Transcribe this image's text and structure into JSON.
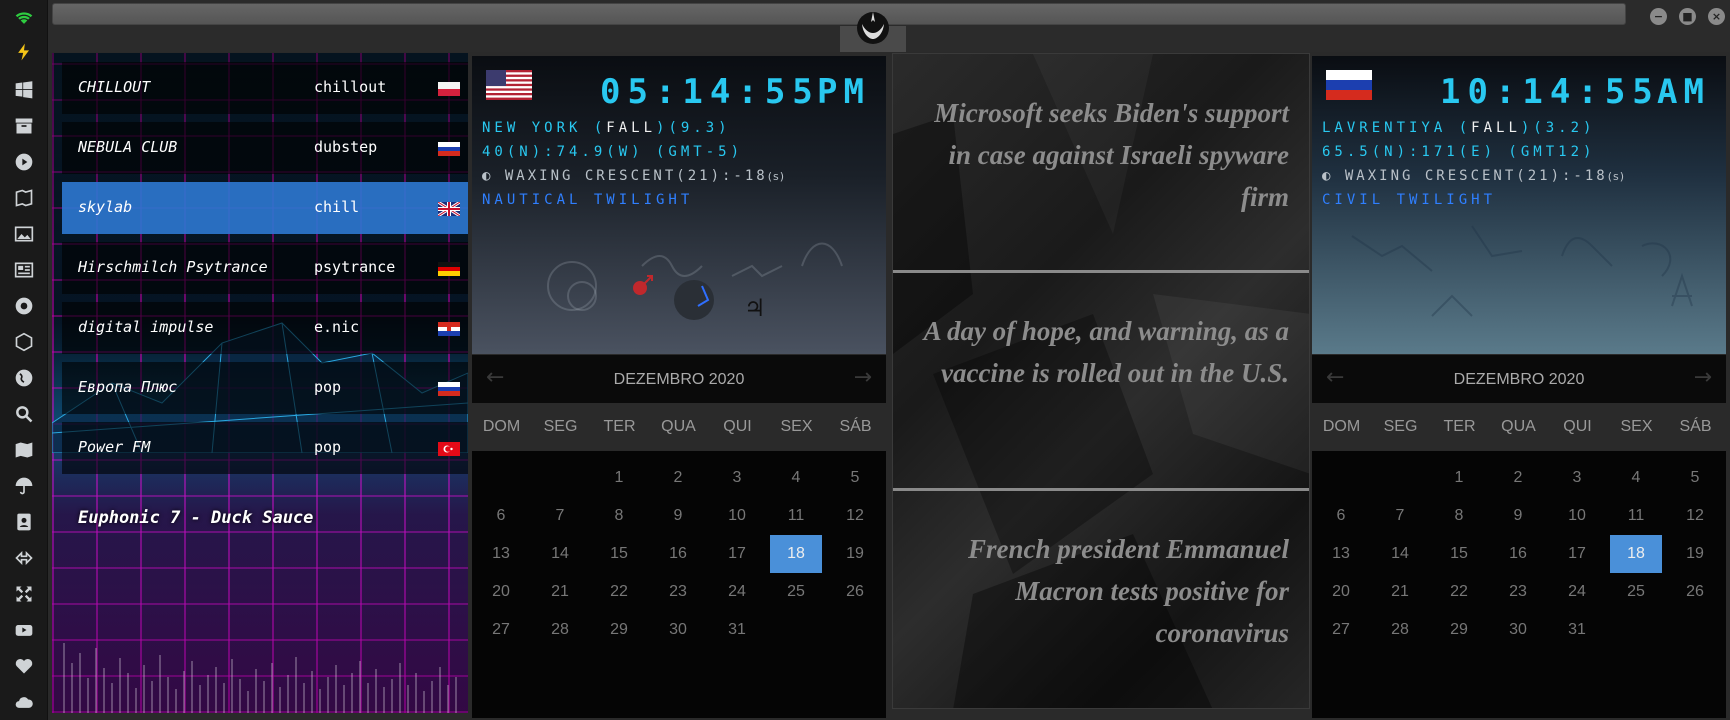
{
  "sidebar": {
    "icons": [
      "wifi-icon",
      "bolt-icon",
      "windows-icon",
      "archive-icon",
      "play-icon",
      "globe-book-icon",
      "image-icon",
      "newspaper-icon",
      "empire-icon",
      "hexagon-icon",
      "globe-icon",
      "search-icon",
      "map-icon",
      "umbrella-icon",
      "contact-icon",
      "exchange-icon",
      "expand-icon",
      "youtube-icon",
      "heart-icon",
      "cloud-icon"
    ],
    "accent": "#2ecc40"
  },
  "window": {
    "minimize": "−",
    "maximize": "■",
    "close": "×"
  },
  "radio": {
    "stations": [
      {
        "name": "CHILLOUT",
        "genre": "chillout",
        "flag": "poland"
      },
      {
        "name": "NEBULA CLUB",
        "genre": "dubstep",
        "flag": "russia"
      },
      {
        "name": "skylab",
        "genre": "chill",
        "flag": "uk",
        "selected": true
      },
      {
        "name": "Hirschmilch Psytrance",
        "genre": "psytrance",
        "flag": "germany"
      },
      {
        "name": "digital impulse",
        "genre": "e.nic",
        "flag": "croatia"
      },
      {
        "name": "Европа Плюс",
        "genre": "pop",
        "flag": "russia"
      },
      {
        "name": "Power FM",
        "genre": "pop",
        "flag": "turkey"
      }
    ],
    "now_playing": "Euphonic 7 - Duck Sauce"
  },
  "clocks": [
    {
      "flag": "usa",
      "time": "05:14:55",
      "ampm": "PM",
      "location_prefix": "NEW YORK (",
      "season": "FALL",
      "location_suffix": ")(9.3)",
      "coords": "40(N):74.9(W) (GMT-5)",
      "moon": "WAXING CRESCENT(21):-18",
      "moon_unit": "(s)",
      "twilight": "NAUTICAL TWILIGHT"
    },
    {
      "flag": "russia",
      "time": "10:14:55",
      "ampm": "AM",
      "location_prefix": "LAVRENTIYA (",
      "season": "FALL",
      "location_suffix": ")(3.2)",
      "coords": "65.5(N):171(E) (GMT12)",
      "moon": "WAXING CRESCENT(21):-18",
      "moon_unit": "(s)",
      "twilight": "CIVIL TWILIGHT"
    }
  ],
  "calendar": {
    "month": "DEZEMBRO 2020",
    "prev": "←",
    "next": "→",
    "weekdays": [
      "DOM",
      "SEG",
      "TER",
      "QUA",
      "QUI",
      "SEX",
      "SÁB"
    ],
    "first_weekday": 2,
    "days_in_month": 31,
    "today": 18
  },
  "news": [
    "Microsoft seeks Biden's support in case against Israeli spyware firm",
    "A day of hope, and warning, as a vaccine is rolled out in the U.S.",
    "French president Emmanuel Macron tests positive for coronavirus"
  ]
}
